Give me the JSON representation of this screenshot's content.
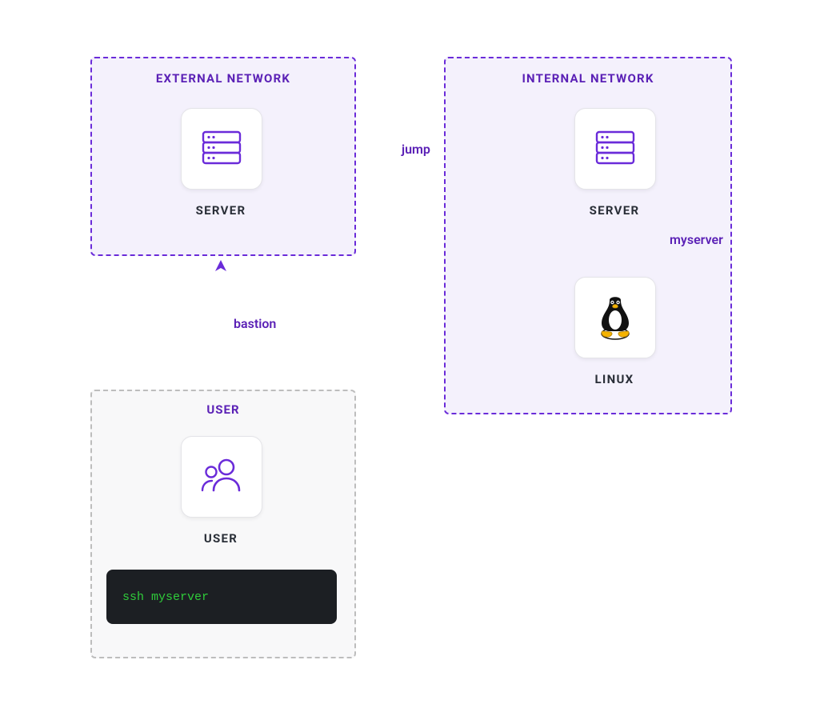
{
  "zones": {
    "external": {
      "title": "EXTERNAL NETWORK"
    },
    "internal": {
      "title": "INTERNAL NETWORK"
    },
    "user": {
      "title": "USER"
    }
  },
  "nodes": {
    "ext_server": {
      "label": "SERVER",
      "icon": "server-icon"
    },
    "int_server": {
      "label": "SERVER",
      "icon": "server-icon"
    },
    "linux_host": {
      "label": "LINUX",
      "icon": "linux-icon"
    },
    "user_card": {
      "label": "USER",
      "icon": "users-icon"
    }
  },
  "edges": {
    "user_to_bastion": {
      "label": "bastion"
    },
    "jump": {
      "label": "jump"
    },
    "myserver": {
      "label": "myserver"
    }
  },
  "terminal": {
    "command": "ssh myserver"
  },
  "colors": {
    "purple": "#6a2bd9",
    "purple_dark": "#5b21b6",
    "purple_fill": "#f4f1fc",
    "gray_border": "#bdbdbd",
    "gray_fill": "#f8f8f9",
    "label": "#2a2f38",
    "terminal_bg": "#1c1f23",
    "terminal_fg": "#2fcc3a"
  }
}
